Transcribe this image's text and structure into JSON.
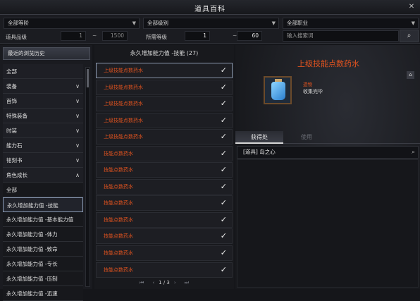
{
  "window": {
    "title": "道具百科",
    "close": "✕"
  },
  "filters": {
    "tier": "全部等阶",
    "grade": "全部级别",
    "job": "全部职业",
    "item_grade_label": "道具品级",
    "item_grade_min": "1",
    "item_grade_max": "1500",
    "req_level_label": "所需等级",
    "req_level_min": "1",
    "req_level_max": "60",
    "tilde": "~",
    "search_placeholder": "输入搜索词"
  },
  "sidebar": {
    "history_button": "最近的浏览历史",
    "categories": [
      {
        "label": "全部",
        "chevron": ""
      },
      {
        "label": "装备",
        "chevron": "∨"
      },
      {
        "label": "首饰",
        "chevron": "∨"
      },
      {
        "label": "特殊装备",
        "chevron": "∨"
      },
      {
        "label": "时装",
        "chevron": "∨"
      },
      {
        "label": "能力石",
        "chevron": "∨"
      },
      {
        "label": "铭刻书",
        "chevron": "∨"
      },
      {
        "label": "角色成长",
        "chevron": "∧"
      },
      {
        "label": "全部",
        "chevron": ""
      },
      {
        "label": "永久增加能力值 -技能",
        "chevron": ""
      },
      {
        "label": "永久增加能力值 -基本能力值",
        "chevron": ""
      },
      {
        "label": "永久增加能力值 -体力",
        "chevron": ""
      },
      {
        "label": "永久增加能力值 -致命",
        "chevron": ""
      },
      {
        "label": "永久增加能力值 -专长",
        "chevron": ""
      },
      {
        "label": "永久增加能力值 -压制",
        "chevron": ""
      },
      {
        "label": "永久增加能力值 -迅速",
        "chevron": ""
      }
    ]
  },
  "list": {
    "header": "永久增加能力值 -技能 (27)",
    "items": [
      "上级技能点数药水",
      "上级技能点数药水",
      "上级技能点数药水",
      "上级技能点数药水",
      "上级技能点数药水",
      "技能点数药水",
      "技能点数药水",
      "技能点数药水",
      "技能点数药水",
      "技能点数药水",
      "技能点数药水",
      "技能点数药水",
      "技能点数药水"
    ],
    "check": "✓",
    "page": "1 / 3",
    "first": "⏮",
    "prev": "‹",
    "next": "›",
    "last": "⏭"
  },
  "detail": {
    "name": "上级技能点数药水",
    "grade": "遗物",
    "status": "收集完毕",
    "tab_obtain": "获得处",
    "tab_use": "使用",
    "source": "[道具] 岛之心",
    "colors": {
      "relic": "#e0531f"
    }
  }
}
